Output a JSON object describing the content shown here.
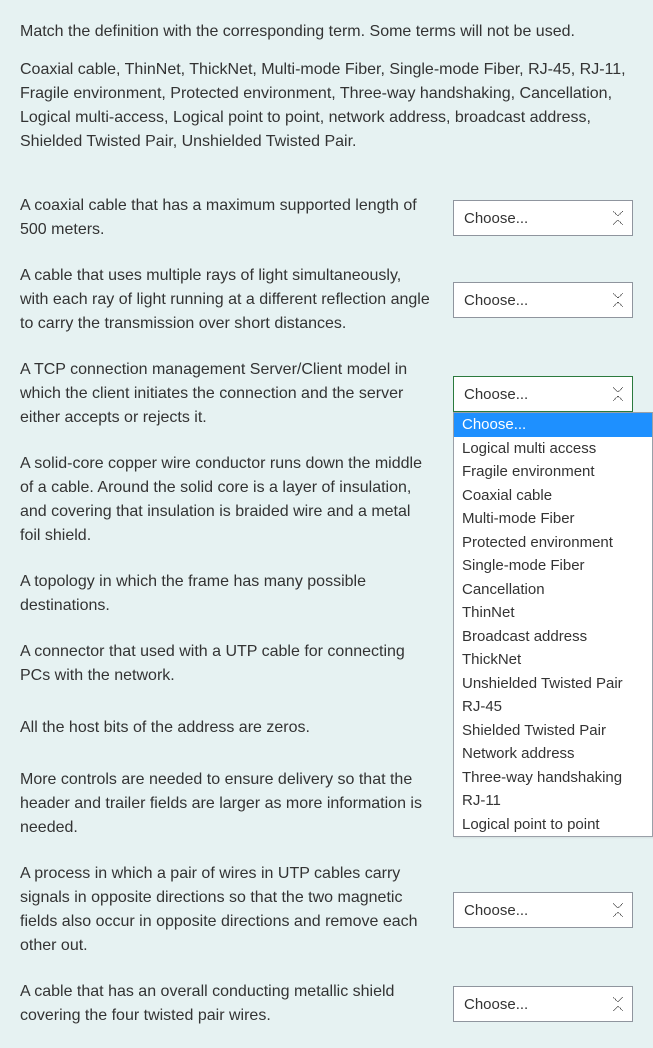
{
  "intro": {
    "instruction": "Match the definition with the corresponding term. Some terms will not be used.",
    "terms": "Coaxial cable, ThinNet, ThickNet, Multi-mode Fiber, Single-mode Fiber, RJ-45, RJ-11, Fragile environment, Protected environment, Three-way handshaking, Cancellation, Logical multi-access, Logical point to point, network address, broadcast address, Shielded Twisted Pair, Unshielded Twisted Pair."
  },
  "placeholder": "Choose...",
  "options": [
    "Choose...",
    "Logical multi access",
    "Fragile environment",
    "Coaxial cable",
    "Multi-mode Fiber",
    "Protected environment",
    "Single-mode Fiber",
    "Cancellation",
    "ThinNet",
    "Broadcast address",
    "ThickNet",
    "Unshielded Twisted Pair",
    "RJ-45",
    "Shielded Twisted Pair",
    "Network address",
    "Three-way handshaking",
    "RJ-11",
    "Logical point to point"
  ],
  "questions": [
    {
      "text": "A coaxial cable that has a maximum supported length of 500 meters.",
      "open": false
    },
    {
      "text": "A cable that uses multiple rays of light simultaneously, with each ray of light running at a different reflection angle to carry the transmission over short distances.",
      "open": false
    },
    {
      "text": "A TCP connection management Server/Client model in which the client initiates the connection and the server either accepts or rejects it.",
      "open": true
    },
    {
      "text": "A solid-core copper wire conductor runs down the middle of a cable. Around the solid core is a layer of insulation, and covering that insulation is braided wire and a metal foil shield.",
      "open": false,
      "hidden": true
    },
    {
      "text": "A topology in which the frame has many possible destinations.",
      "open": false,
      "hidden": true
    },
    {
      "text": "A connector that used with a UTP cable for connecting PCs with the network.",
      "open": false,
      "hidden": true
    },
    {
      "text": "All the host bits of the address are zeros.",
      "open": false,
      "hidden": true
    },
    {
      "text": "More controls are needed to ensure delivery so that the header and trailer fields are larger as more information is needed.",
      "open": false,
      "hidden": true
    },
    {
      "text": "A process in which a pair of wires in UTP cables carry signals in opposite directions so that the two magnetic fields also occur in opposite directions and remove each other out.",
      "open": false
    },
    {
      "text": "A cable that has an overall conducting metallic shield covering the four twisted pair wires.",
      "open": false
    }
  ]
}
